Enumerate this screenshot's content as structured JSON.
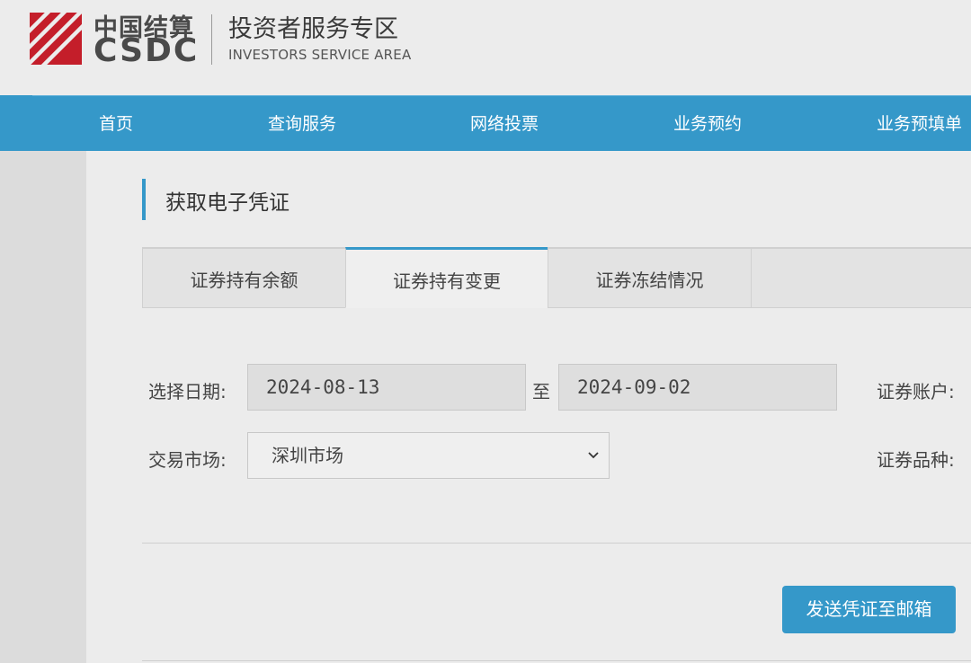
{
  "header": {
    "logo_cn": "中国结算",
    "logo_en": "CSDC",
    "area_title_cn": "投资者服务专区",
    "area_title_en": "INVESTORS SERVICE AREA"
  },
  "nav": {
    "items": [
      {
        "label": "首页"
      },
      {
        "label": "查询服务"
      },
      {
        "label": "网络投票"
      },
      {
        "label": "业务预约"
      },
      {
        "label": "业务预填单"
      }
    ]
  },
  "page": {
    "title": "获取电子凭证"
  },
  "tabs": [
    {
      "label": "证券持有余额",
      "active": false
    },
    {
      "label": "证券持有变更",
      "active": true
    },
    {
      "label": "证券冻结情况",
      "active": false
    }
  ],
  "form": {
    "date_label": "选择日期:",
    "date_from": "2024-08-13",
    "date_separator": "至",
    "date_to": "2024-09-02",
    "account_label": "证券账户:",
    "market_label": "交易市场:",
    "market_value": "深圳市场",
    "security_type_label": "证券品种:",
    "send_button": "发送凭证至邮箱"
  },
  "colors": {
    "brand_blue": "#3598c9",
    "logo_red": "#d0202d"
  },
  "icons": {
    "logo": "csdc-logo-icon",
    "dropdown": "chevron-down-icon"
  }
}
